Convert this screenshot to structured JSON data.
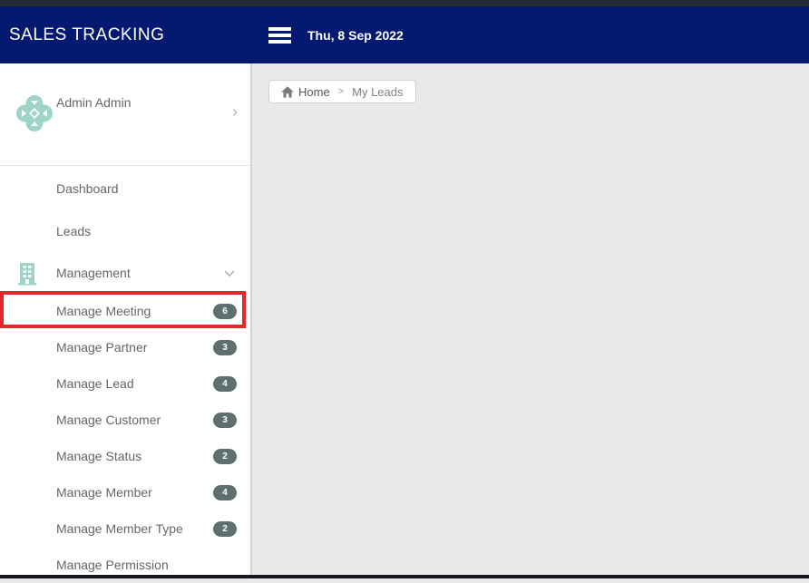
{
  "header": {
    "title": "SALES TRACKING",
    "date": "Thu, 8 Sep 2022"
  },
  "sidebar": {
    "user": {
      "name": "Admin Admin"
    },
    "items": [
      {
        "label": "Dashboard"
      },
      {
        "label": "Leads"
      },
      {
        "label": "Management"
      }
    ],
    "submenu": [
      {
        "label": "Manage Meeting",
        "badge": "6"
      },
      {
        "label": "Manage Partner",
        "badge": "3"
      },
      {
        "label": "Manage Lead",
        "badge": "4"
      },
      {
        "label": "Manage Customer",
        "badge": "3"
      },
      {
        "label": "Manage Status",
        "badge": "2"
      },
      {
        "label": "Manage Member",
        "badge": "4"
      },
      {
        "label": "Manage Member Type",
        "badge": "2"
      },
      {
        "label": "Manage Permission",
        "badge": ""
      }
    ]
  },
  "breadcrumb": {
    "home": "Home",
    "current": "My Leads"
  },
  "colors": {
    "header_navy": "#041a70",
    "badge_slate": "#5d6f6e",
    "accent_teal": "#9ed3c8",
    "highlight_red": "#e82329"
  }
}
